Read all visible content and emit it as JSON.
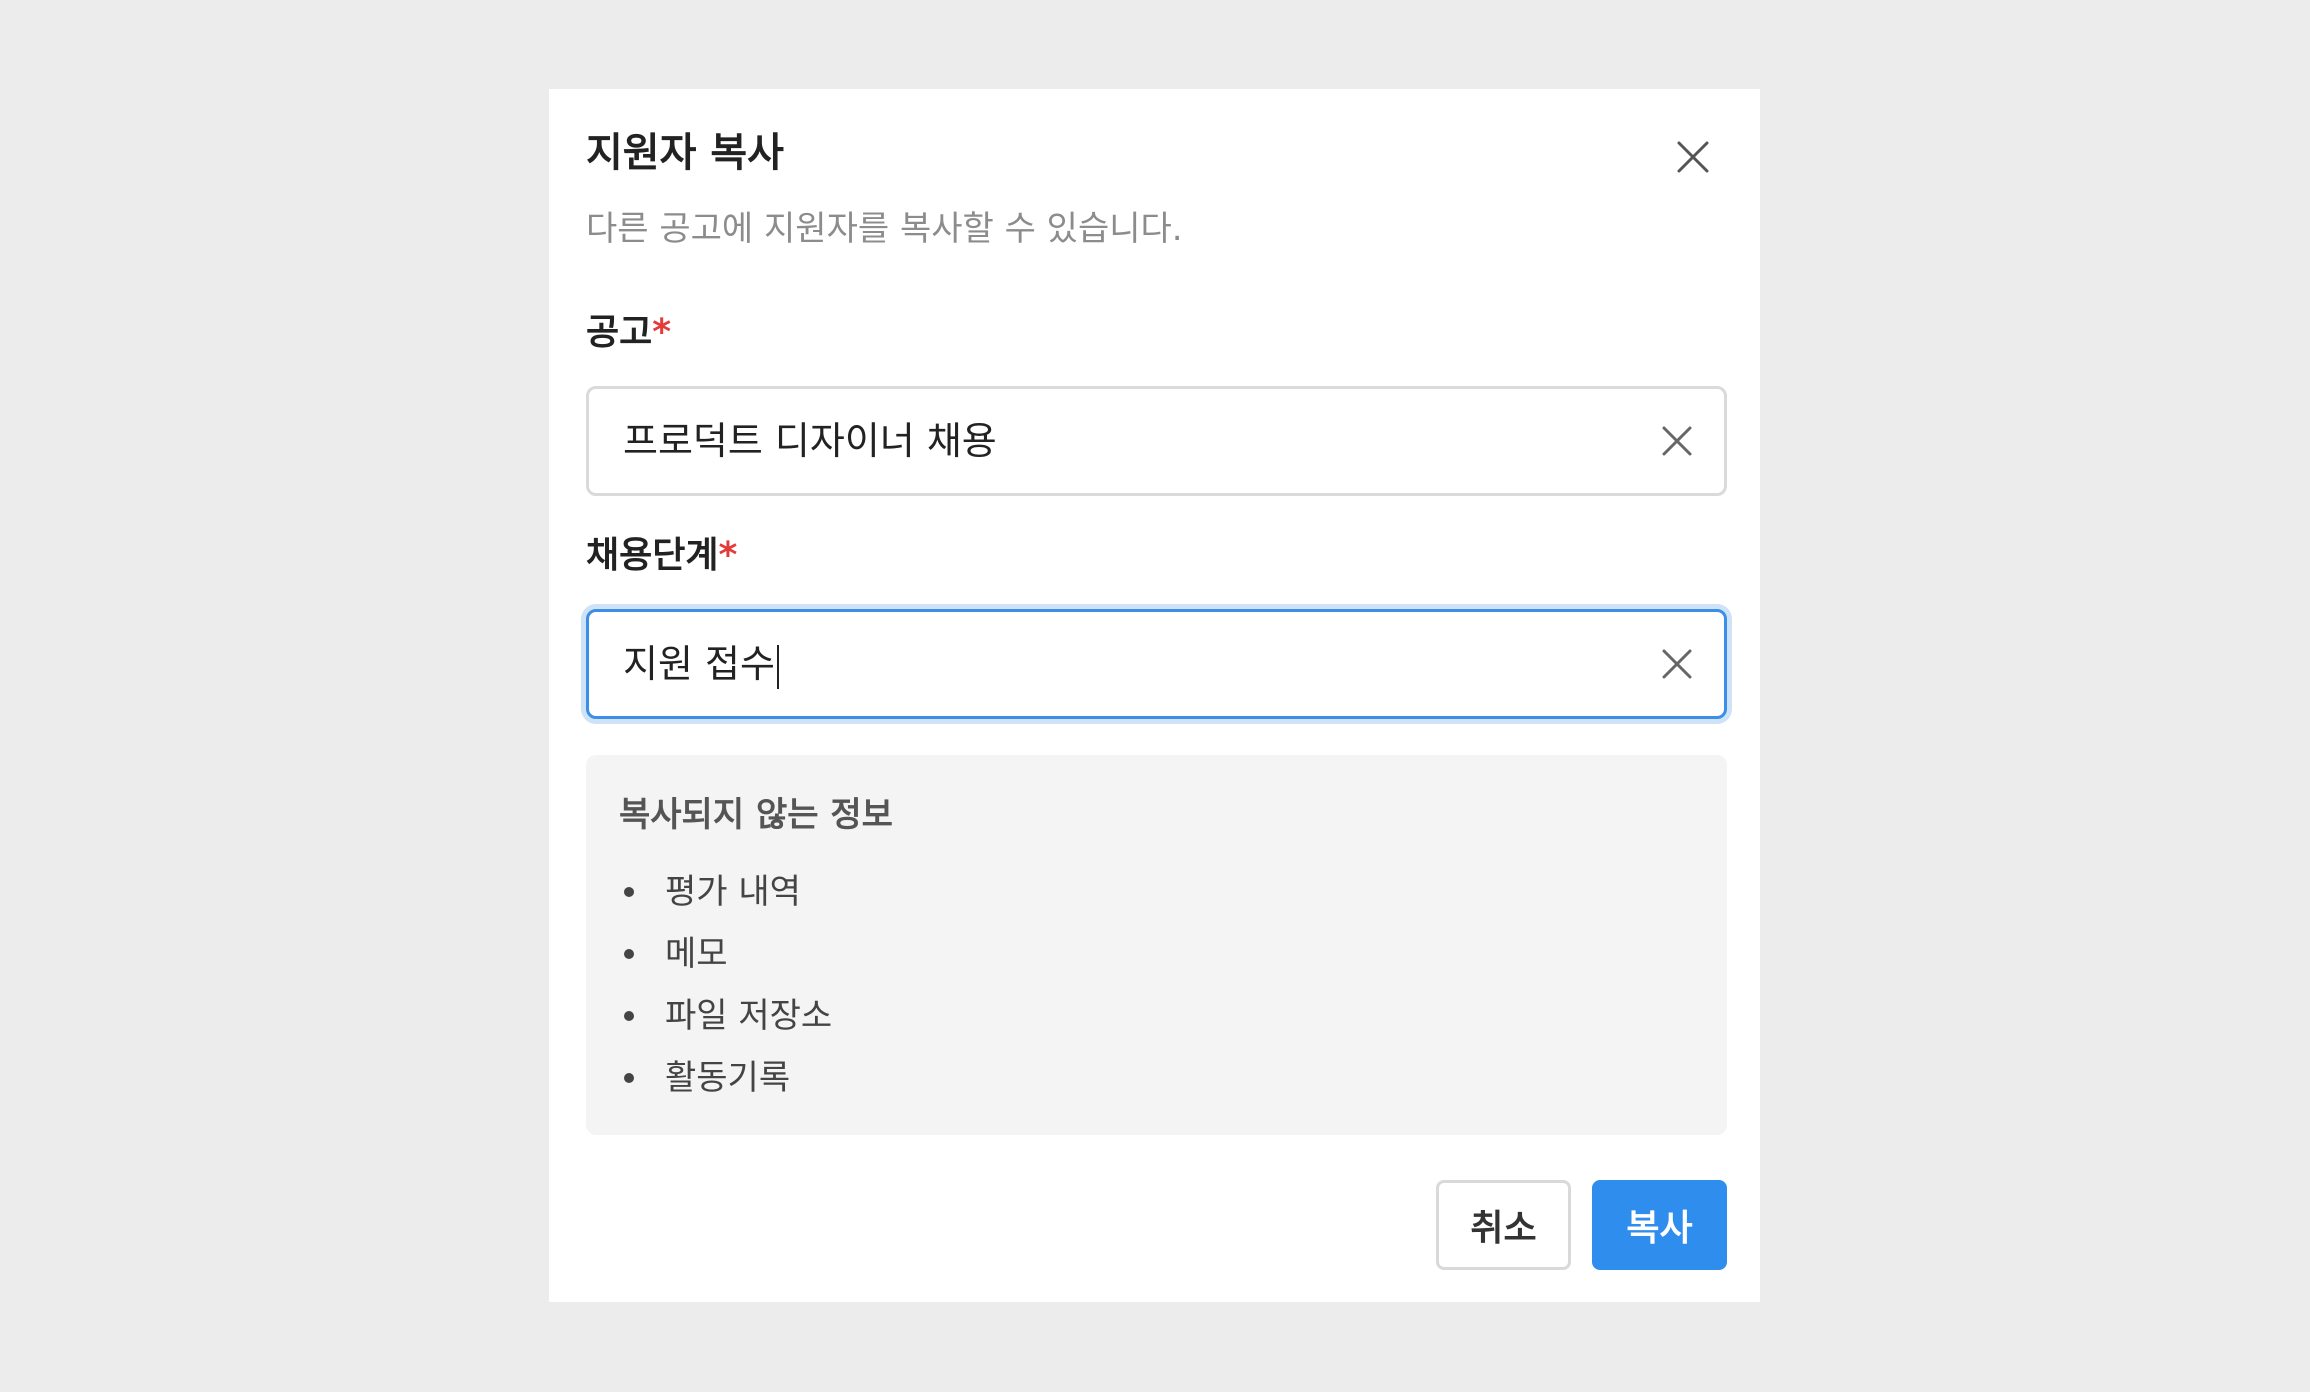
{
  "dialog": {
    "title": "지원자 복사",
    "subtitle": "다른 공고에 지원자를 복사할 수 있습니다.",
    "close_icon": "close-icon"
  },
  "fields": {
    "posting": {
      "label": "공고",
      "required_mark": "*",
      "value": "프로덕트 디자이너 채용",
      "clear_icon": "clear-icon"
    },
    "stage": {
      "label": "채용단계",
      "required_mark": "*",
      "value": "지원 접수",
      "focused": true,
      "clear_icon": "clear-icon"
    }
  },
  "info": {
    "title": "복사되지 않는 정보",
    "items": [
      "평가 내역",
      "메모",
      "파일 저장소",
      "활동기록"
    ]
  },
  "buttons": {
    "cancel": "취소",
    "copy": "복사"
  },
  "colors": {
    "primary": "#2e8ded",
    "required": "#e33b3b",
    "focus_border": "#3d8fe6",
    "overlay": "#ececec",
    "info_bg": "#f4f4f4"
  }
}
